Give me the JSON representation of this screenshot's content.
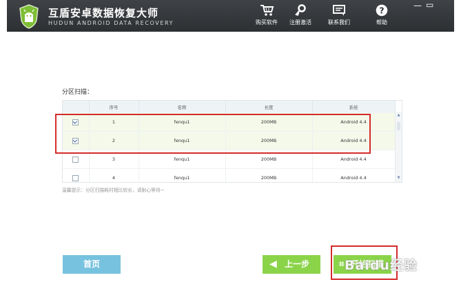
{
  "app": {
    "title": "互盾安卓数据恢复大师",
    "subtitle": "HUDUN ANDROID DATA RECOVERY"
  },
  "nav": [
    {
      "label": "购买软件",
      "icon": "cart-icon"
    },
    {
      "label": "注册激活",
      "icon": "key-icon"
    },
    {
      "label": "联系我们",
      "icon": "chat-icon"
    },
    {
      "label": "帮助",
      "icon": "help-icon"
    }
  ],
  "window_controls": {
    "minimize": "—",
    "restore": "▭"
  },
  "section": {
    "title": "分区扫描："
  },
  "table": {
    "headers": [
      "",
      "序号",
      "名称",
      "长度",
      "系统"
    ],
    "rows": [
      {
        "checked": true,
        "index": "1",
        "name": "fenqu1",
        "length": "200MB",
        "system": "Android 4.4"
      },
      {
        "checked": true,
        "index": "2",
        "name": "fenqu1",
        "length": "200MB",
        "system": "Android 4.4"
      },
      {
        "checked": false,
        "index": "3",
        "name": "fenqu1",
        "length": "200MB",
        "system": "Android 4.4"
      },
      {
        "checked": false,
        "index": "4",
        "name": "fenqu1",
        "length": "200MB",
        "system": "Android 4.4"
      }
    ]
  },
  "hint": "温馨提示：分区扫描耗时相比较长，请耐心等待~",
  "buttons": {
    "home": "首页",
    "prev": "上一步",
    "start": "开始扫描"
  },
  "watermark": "Baidu经验",
  "colors": {
    "titlebar": "#2f3236",
    "highlight": "#d42a2a",
    "green_button": "#8bd44a",
    "blue_button": "#76c2df"
  }
}
